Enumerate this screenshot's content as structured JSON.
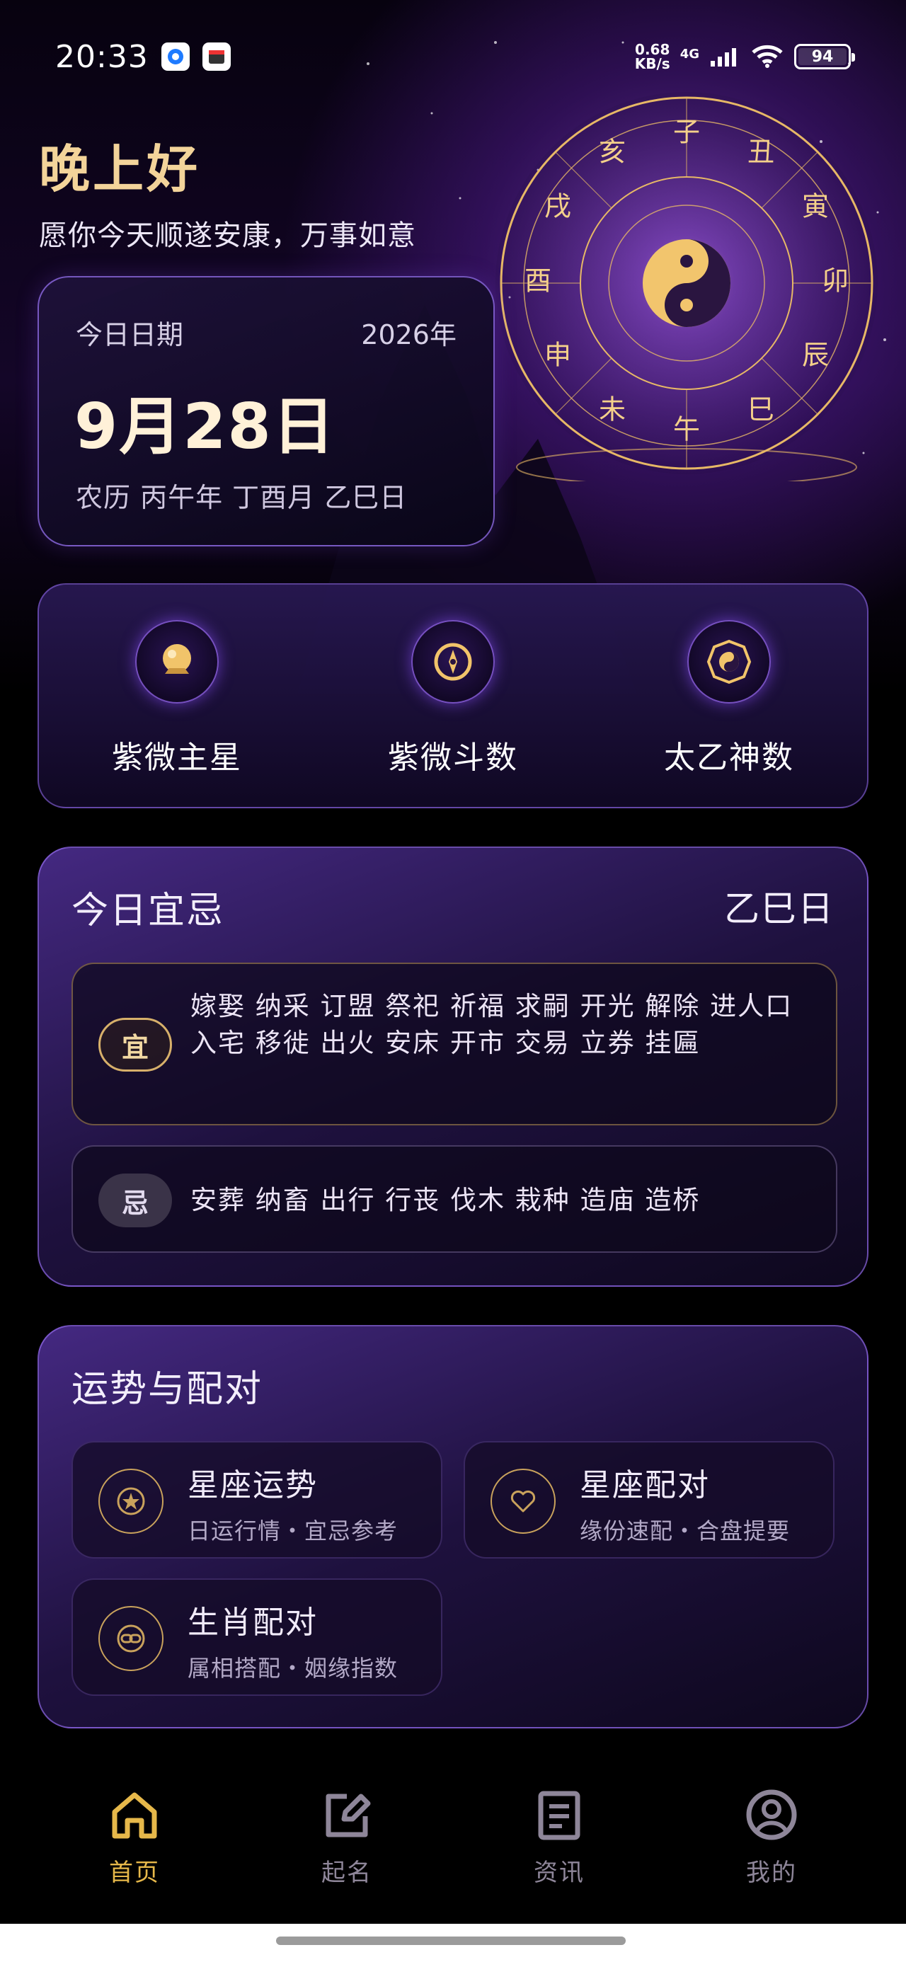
{
  "status_bar": {
    "time": "20:33",
    "net_speed_value": "0.68",
    "net_speed_unit": "KB/s",
    "network_type": "4G",
    "battery": "94"
  },
  "greeting": {
    "title": "晚上好",
    "subtitle": "愿你今天顺遂安康，万事如意"
  },
  "zodiac_wheel": {
    "branches": [
      "子",
      "丑",
      "寅",
      "卯",
      "辰",
      "巳",
      "午",
      "未",
      "申",
      "酉",
      "戌",
      "亥"
    ]
  },
  "date_card": {
    "label": "今日日期",
    "year": "2026年",
    "date": "9月28日",
    "lunar": "农历 丙午年 丁酉月 乙巳日"
  },
  "features": [
    {
      "label": "紫微主星",
      "icon": "crystal-ball-icon"
    },
    {
      "label": "紫微斗数",
      "icon": "compass-icon"
    },
    {
      "label": "太乙神数",
      "icon": "bagua-icon"
    }
  ],
  "yiji": {
    "title": "今日宜忌",
    "day": "乙巳日",
    "yi_badge": "宜",
    "yi_items": "嫁娶 纳采 订盟 祭祀 祈福 求嗣 开光 解除 进人口 入宅 移徙 出火 安床 开市 交易 立券 挂匾",
    "ji_badge": "忌",
    "ji_items": "安葬 纳畜 出行 行丧 伐木 栽种 造庙 造桥"
  },
  "fortune": {
    "title": "运势与配对",
    "items": [
      {
        "title": "星座运势",
        "subtitle": "日运行情・宜忌参考",
        "icon": "star-medal-icon"
      },
      {
        "title": "星座配对",
        "subtitle": "缘份速配・合盘提要",
        "icon": "heart-icon"
      },
      {
        "title": "生肖配对",
        "subtitle": "属相搭配・姻缘指数",
        "icon": "link-icon"
      }
    ]
  },
  "nav": [
    {
      "label": "首页",
      "icon": "home-icon",
      "active": true
    },
    {
      "label": "起名",
      "icon": "edit-icon",
      "active": false
    },
    {
      "label": "资讯",
      "icon": "news-icon",
      "active": false
    },
    {
      "label": "我的",
      "icon": "profile-icon",
      "active": false
    }
  ],
  "colors": {
    "accent_gold": "#e6b84a",
    "greeting_gold": "#f3d49a",
    "card_border_purple": "#9678f0",
    "background": "#000000"
  }
}
